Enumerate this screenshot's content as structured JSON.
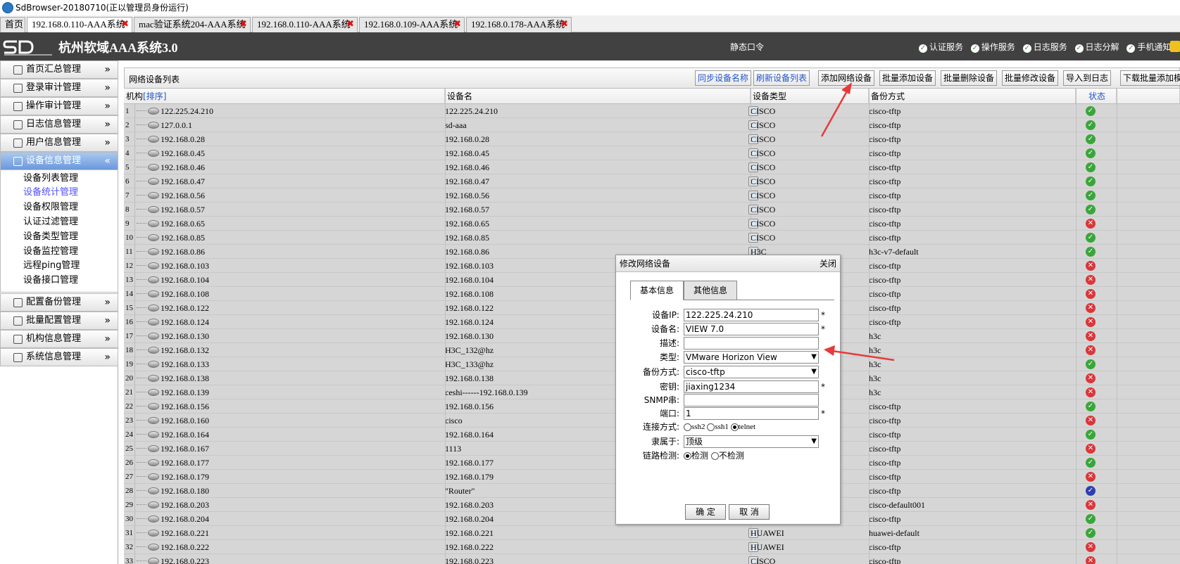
{
  "window": {
    "title": "SdBrowser-20180710(正以管理员身份运行)"
  },
  "tabs": [
    {
      "label": "首页",
      "close": ""
    },
    {
      "label": "192.168.0.110-AAA系统",
      "close": "✖"
    },
    {
      "label": "mac验证系统204-AAA系统",
      "close": "✖"
    },
    {
      "label": "192.168.0.110-AAA系统",
      "close": "✖"
    },
    {
      "label": "192.168.0.109-AAA系统",
      "close": "✖"
    },
    {
      "label": "192.168.0.178-AAA系统",
      "close": "✖"
    }
  ],
  "header": {
    "title": "杭州软域AAA系统3.0",
    "static_password": "静态口令",
    "services": [
      "认证服务",
      "操作服务",
      "日志服务",
      "日志分解",
      "手机通知"
    ]
  },
  "sidebar": {
    "menus": [
      {
        "label": "首页汇总管理",
        "arrow": "»"
      },
      {
        "label": "登录审计管理",
        "arrow": "»"
      },
      {
        "label": "操作审计管理",
        "arrow": "»"
      },
      {
        "label": "日志信息管理",
        "arrow": "»"
      },
      {
        "label": "用户信息管理",
        "arrow": "»"
      },
      {
        "label": "设备信息管理",
        "arrow": "«"
      },
      {
        "label": "配置备份管理",
        "arrow": "»"
      },
      {
        "label": "批量配置管理",
        "arrow": "»"
      },
      {
        "label": "机构信息管理",
        "arrow": "»"
      },
      {
        "label": "系统信息管理",
        "arrow": "»"
      }
    ],
    "submenu": [
      "设备列表管理",
      "设备统计管理",
      "设备权限管理",
      "认证过滤管理",
      "设备类型管理",
      "设备监控管理",
      "远程ping管理",
      "设备接口管理"
    ],
    "active_menu": "设备信息管理",
    "selected_sub": "设备统计管理"
  },
  "toolbar": {
    "list_title": "网络设备列表",
    "buttons": [
      "同步设备名称",
      "刷新设备列表",
      "添加网络设备",
      "批量添加设备",
      "批量删除设备",
      "批量修改设备",
      "导入到日志",
      "下载批量添加模"
    ]
  },
  "table": {
    "headers": {
      "org": "机构",
      "sort": "[排序]",
      "name": "设备名",
      "type": "设备类型",
      "backup": "备份方式",
      "status": "状态"
    },
    "rows": [
      {
        "n": "1",
        "ip": "122.225.24.210",
        "name": "122.225.24.210",
        "type": "CISCO",
        "backup": "cisco-tftp",
        "status": "ok"
      },
      {
        "n": "2",
        "ip": "127.0.0.1",
        "name": "sd-aaa",
        "type": "CISCO",
        "backup": "cisco-tftp",
        "status": "ok"
      },
      {
        "n": "3",
        "ip": "192.168.0.28",
        "name": "192.168.0.28",
        "type": "CISCO",
        "backup": "cisco-tftp",
        "status": "ok"
      },
      {
        "n": "4",
        "ip": "192.168.0.45",
        "name": "192.168.0.45",
        "type": "CISCO",
        "backup": "cisco-tftp",
        "status": "ok"
      },
      {
        "n": "5",
        "ip": "192.168.0.46",
        "name": "192.168.0.46",
        "type": "CISCO",
        "backup": "cisco-tftp",
        "status": "ok"
      },
      {
        "n": "6",
        "ip": "192.168.0.47",
        "name": "192.168.0.47",
        "type": "CISCO",
        "backup": "cisco-tftp",
        "status": "ok"
      },
      {
        "n": "7",
        "ip": "192.168.0.56",
        "name": "192.168.0.56",
        "type": "CISCO",
        "backup": "cisco-tftp",
        "status": "ok"
      },
      {
        "n": "8",
        "ip": "192.168.0.57",
        "name": "192.168.0.57",
        "type": "CISCO",
        "backup": "cisco-tftp",
        "status": "ok"
      },
      {
        "n": "9",
        "ip": "192.168.0.65",
        "name": "192.168.0.65",
        "type": "CISCO",
        "backup": "cisco-tftp",
        "status": "err"
      },
      {
        "n": "10",
        "ip": "192.168.0.85",
        "name": "192.168.0.85",
        "type": "CISCO",
        "backup": "cisco-tftp",
        "status": "ok"
      },
      {
        "n": "11",
        "ip": "192.168.0.86",
        "name": "192.168.0.86",
        "type": "H3C",
        "backup": "h3c-v7-default",
        "status": "ok"
      },
      {
        "n": "12",
        "ip": "192.168.0.103",
        "name": "192.168.0.103",
        "type": "",
        "backup": "cisco-tftp",
        "status": "err"
      },
      {
        "n": "13",
        "ip": "192.168.0.104",
        "name": "192.168.0.104",
        "type": "",
        "backup": "cisco-tftp",
        "status": "err"
      },
      {
        "n": "14",
        "ip": "192.168.0.108",
        "name": "192.168.0.108",
        "type": "",
        "backup": "cisco-tftp",
        "status": "err"
      },
      {
        "n": "15",
        "ip": "192.168.0.122",
        "name": "192.168.0.122",
        "type": "",
        "backup": "cisco-tftp",
        "status": "err"
      },
      {
        "n": "16",
        "ip": "192.168.0.124",
        "name": "192.168.0.124",
        "type": "",
        "backup": "cisco-tftp",
        "status": "err"
      },
      {
        "n": "17",
        "ip": "192.168.0.130",
        "name": "192.168.0.130",
        "type": "",
        "backup": "h3c",
        "status": "err"
      },
      {
        "n": "18",
        "ip": "192.168.0.132",
        "name": "H3C_132@hz",
        "type": "",
        "backup": "h3c",
        "status": "err"
      },
      {
        "n": "19",
        "ip": "192.168.0.133",
        "name": "H3C_133@hz",
        "type": "",
        "backup": "h3c",
        "status": "ok"
      },
      {
        "n": "20",
        "ip": "192.168.0.138",
        "name": "192.168.0.138",
        "type": "",
        "backup": "h3c",
        "status": "err"
      },
      {
        "n": "21",
        "ip": "192.168.0.139",
        "name": "ceshi------192.168.0.139",
        "type": "",
        "backup": "h3c",
        "status": "err"
      },
      {
        "n": "22",
        "ip": "192.168.0.156",
        "name": "192.168.0.156",
        "type": "",
        "backup": "cisco-tftp",
        "status": "ok"
      },
      {
        "n": "23",
        "ip": "192.168.0.160",
        "name": "cisco",
        "type": "",
        "backup": "cisco-tftp",
        "status": "err"
      },
      {
        "n": "24",
        "ip": "192.168.0.164",
        "name": "192.168.0.164",
        "type": "",
        "backup": "cisco-tftp",
        "status": "ok"
      },
      {
        "n": "25",
        "ip": "192.168.0.167",
        "name": "1113",
        "type": "",
        "backup": "cisco-tftp",
        "status": "err"
      },
      {
        "n": "26",
        "ip": "192.168.0.177",
        "name": "192.168.0.177",
        "type": "",
        "backup": "cisco-tftp",
        "status": "ok"
      },
      {
        "n": "27",
        "ip": "192.168.0.179",
        "name": "192.168.0.179",
        "type": "",
        "backup": "cisco-tftp",
        "status": "err"
      },
      {
        "n": "28",
        "ip": "192.168.0.180",
        "name": "\"Router\"",
        "type": "",
        "backup": "cisco-tftp",
        "status": "blue"
      },
      {
        "n": "29",
        "ip": "192.168.0.203",
        "name": "192.168.0.203",
        "type": "",
        "backup": "cisco-default001",
        "status": "err"
      },
      {
        "n": "30",
        "ip": "192.168.0.204",
        "name": "192.168.0.204",
        "type": "",
        "backup": "cisco-tftp",
        "status": "ok"
      },
      {
        "n": "31",
        "ip": "192.168.0.221",
        "name": "192.168.0.221",
        "type": "HUAWEI",
        "backup": "huawei-default",
        "status": "ok"
      },
      {
        "n": "32",
        "ip": "192.168.0.222",
        "name": "192.168.0.222",
        "type": "HUAWEI",
        "backup": "cisco-tftp",
        "status": "err"
      },
      {
        "n": "33",
        "ip": "192.168.0.223",
        "name": "192.168.0.223",
        "type": "CISCO",
        "backup": "cisco-tftp",
        "status": "err"
      }
    ]
  },
  "status_icons": {
    "ok": "✓",
    "err": "✕",
    "blue": "✓"
  },
  "status_colors": {
    "ok": "#3aa63a",
    "err": "#d9373a",
    "blue": "#2f3fb0"
  },
  "dialog": {
    "title": "修改网络设备",
    "close": "关闭",
    "tabs": [
      "基本信息",
      "其他信息"
    ],
    "labels": {
      "ip": "设备IP:",
      "name": "设备名:",
      "desc": "描述:",
      "type": "类型:",
      "backup": "备份方式:",
      "key": "密钥:",
      "snmp": "SNMP串:",
      "port": "端口:",
      "conn": "连接方式:",
      "belong": "隶属于:",
      "link": "链路检测:"
    },
    "values": {
      "ip": "122.225.24.210",
      "name": "VIEW 7.0",
      "desc": "",
      "type": "VMware Horizon View",
      "backup": "cisco-tftp",
      "key": "jiaxing1234",
      "snmp": "",
      "port": "1",
      "belong": "顶级"
    },
    "required": "*",
    "conn_options": [
      "ssh2",
      "ssh1",
      "telnet"
    ],
    "conn_selected": "telnet",
    "link_options": [
      "检测",
      "不检测"
    ],
    "link_selected": "检测",
    "ok": "确 定",
    "cancel": "取 消"
  },
  "annotation_color": "#e83a3a"
}
